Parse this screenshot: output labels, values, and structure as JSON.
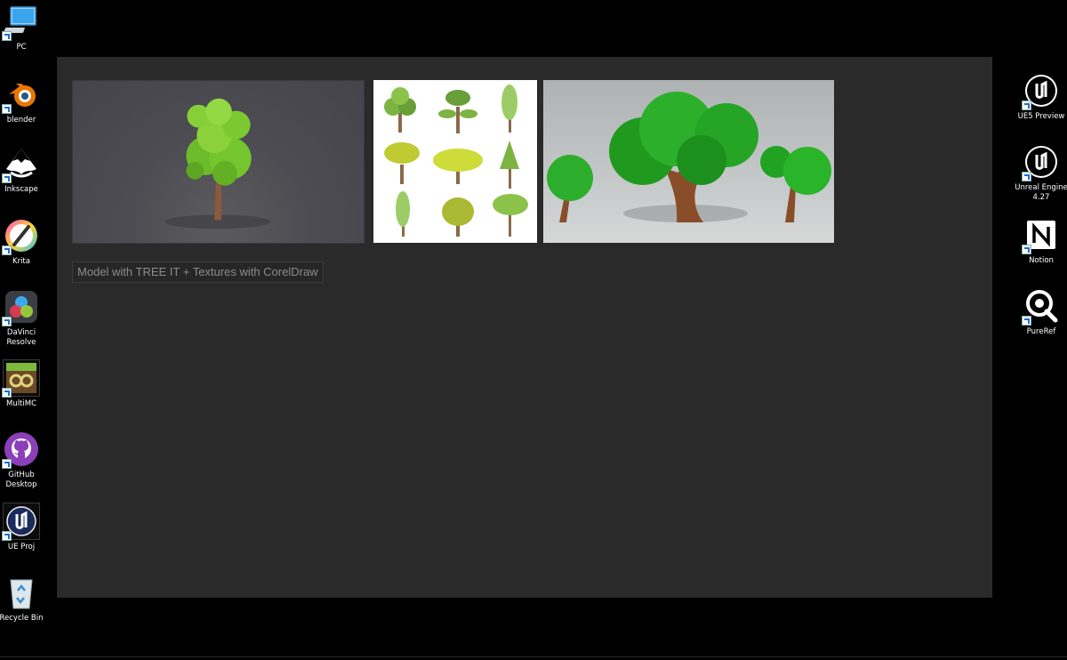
{
  "desktop": {
    "left_icons": [
      {
        "label": "PC",
        "icon": "pc-monitor-icon"
      },
      {
        "label": "blender",
        "icon": "blender-icon"
      },
      {
        "label": "Inkscape",
        "icon": "inkscape-icon"
      },
      {
        "label": "Krita",
        "icon": "krita-icon"
      },
      {
        "label": "DaVinci Resolve",
        "icon": "davinci-resolve-icon"
      },
      {
        "label": "MultiMC",
        "icon": "multimc-icon"
      },
      {
        "label": "GitHub Desktop",
        "icon": "github-desktop-icon"
      },
      {
        "label": "UE Proj",
        "icon": "unreal-engine-icon"
      },
      {
        "label": "Recycle Bin",
        "icon": "recycle-bin-icon"
      }
    ],
    "right_icons": [
      {
        "label": "UE5 Preview",
        "icon": "unreal-engine-icon"
      },
      {
        "label": "Unreal Engine 4.27",
        "icon": "unreal-engine-icon"
      },
      {
        "label": "Notion",
        "icon": "notion-icon"
      },
      {
        "label": "PureRef",
        "icon": "pureref-icon"
      }
    ]
  },
  "pureref": {
    "images": [
      {
        "name": "tree-model-render",
        "icon": "tree-image"
      },
      {
        "name": "tree-illustration-sheet",
        "icon": "tree-image"
      },
      {
        "name": "stylized-trees-render",
        "icon": "tree-image"
      }
    ],
    "note": "Model with TREE IT + Textures with CorelDraw"
  },
  "colors": {
    "desktop_bg": "#000000",
    "canvas_bg": "#2a2a2a",
    "note_text": "#8c8c8c"
  }
}
